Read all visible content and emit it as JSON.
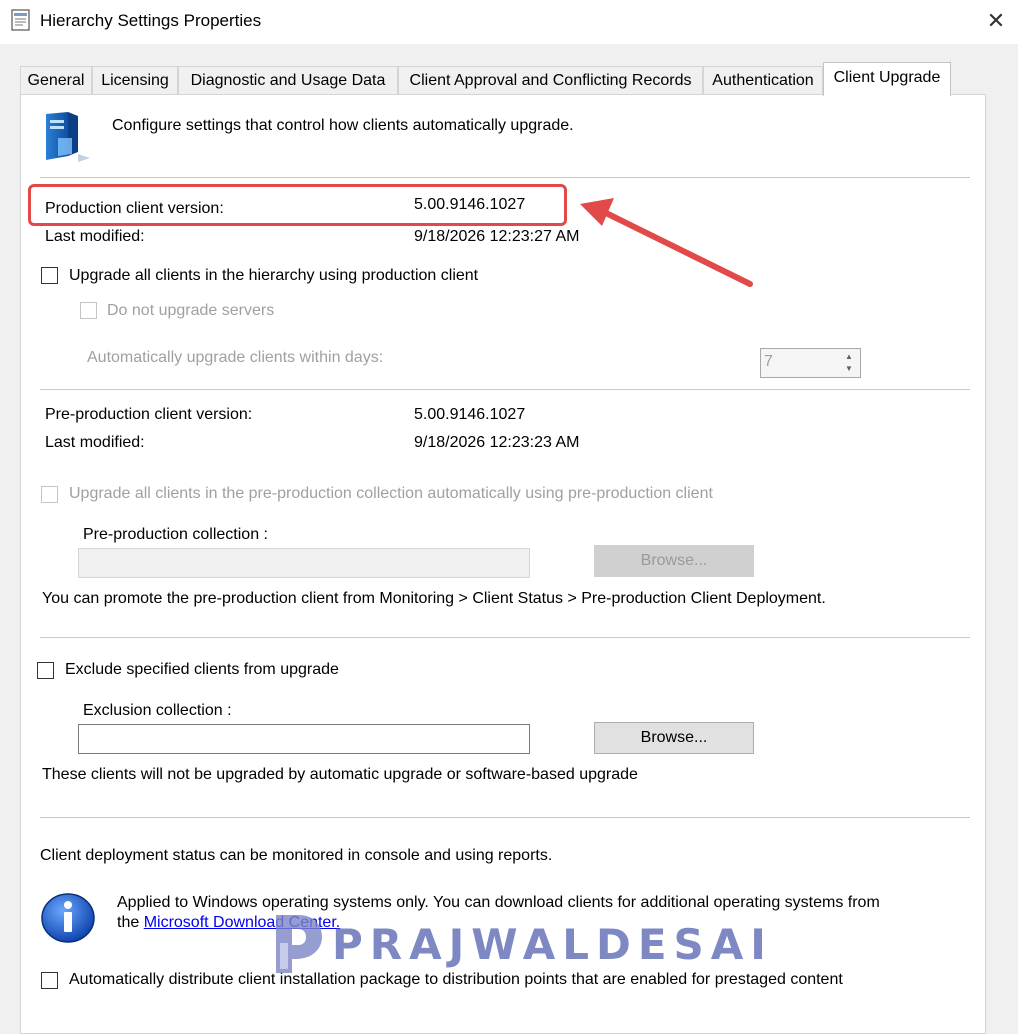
{
  "window": {
    "title": "Hierarchy Settings Properties",
    "close_glyph": "✕"
  },
  "tabs": [
    {
      "label": "General"
    },
    {
      "label": "Licensing"
    },
    {
      "label": "Diagnostic and Usage Data"
    },
    {
      "label": "Client Approval and Conflicting Records"
    },
    {
      "label": "Authentication"
    },
    {
      "label": "Client Upgrade",
      "active": true
    }
  ],
  "header": {
    "description": "Configure settings that control how clients automatically upgrade."
  },
  "production": {
    "version_label": "Production client version:",
    "version_value": "5.00.9146.1027",
    "modified_label": "Last modified:",
    "modified_value": "9/18/2026 12:23:27 AM",
    "upgrade_all_label": "Upgrade all clients in the hierarchy using production client",
    "no_servers_label": "Do not upgrade servers",
    "days_label": "Automatically upgrade clients within days:",
    "days_value": "7"
  },
  "preproduction": {
    "version_label": "Pre-production client version:",
    "version_value": "5.00.9146.1027",
    "modified_label": "Last modified:",
    "modified_value": "9/18/2026 12:23:23 AM",
    "upgrade_label": "Upgrade all clients in the pre-production collection automatically using pre-production client",
    "collection_label": "Pre-production collection :",
    "browse_label": "Browse...",
    "promote_note": "You can promote the pre-production client from Monitoring > Client Status > Pre-production Client Deployment."
  },
  "exclusion": {
    "exclude_label": "Exclude specified clients from upgrade",
    "collection_label": "Exclusion collection :",
    "browse_label": "Browse...",
    "note": "These clients will not be upgraded by automatic upgrade or software-based upgrade"
  },
  "deployment": {
    "status_note": "Client deployment status can be monitored in console and using reports.",
    "info_line1": "Applied to Windows operating systems only. You can download clients for additional operating systems from",
    "info_line2_prefix": "the ",
    "link_text": "Microsoft Download Center.",
    "distribute_label": "Automatically distribute client installation package to distribution points that are enabled for prestaged content"
  },
  "watermark": {
    "text": "PRAJWALDESAI"
  },
  "colors": {
    "highlight": "#e24a4a",
    "link": "#0000ee",
    "watermark": "#5f6bb3"
  }
}
